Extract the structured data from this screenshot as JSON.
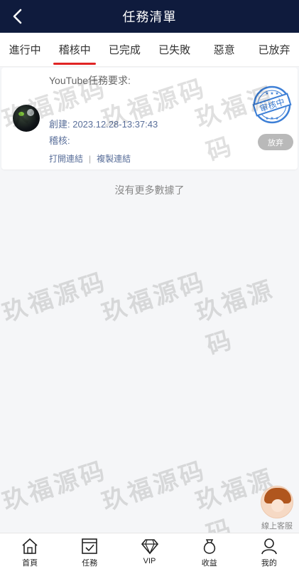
{
  "header": {
    "title": "任務清單",
    "back_icon": "chevron-left-icon"
  },
  "tabs": [
    {
      "label": "進行中",
      "active": false
    },
    {
      "label": "稽核中",
      "active": true
    },
    {
      "label": "已完成",
      "active": false
    },
    {
      "label": "已失敗",
      "active": false
    },
    {
      "label": "惡意",
      "active": false
    },
    {
      "label": "已放弃",
      "active": false
    }
  ],
  "task": {
    "requirement": "YouTube任務要求:",
    "created": "創建: 2023.12.28-13:37:43",
    "review": "稽核:",
    "open_link": "打開連結",
    "separator": "|",
    "copy_link": "複製連結",
    "stamp_text": "审核中",
    "give_up": "放弃"
  },
  "list": {
    "no_more": "沒有更多數據了"
  },
  "watermark": "玖福源码",
  "support": {
    "label": "線上客服"
  },
  "nav": [
    {
      "label": "首頁",
      "icon": "home-icon"
    },
    {
      "label": "任務",
      "icon": "task-icon"
    },
    {
      "label": "VIP",
      "icon": "diamond-icon"
    },
    {
      "label": "收益",
      "icon": "money-bag-icon"
    },
    {
      "label": "我的",
      "icon": "user-icon"
    }
  ],
  "colors": {
    "header_bg": "#0f1b3d",
    "tab_indicator": "#e02424",
    "stamp_blue": "#3d7fd6"
  }
}
